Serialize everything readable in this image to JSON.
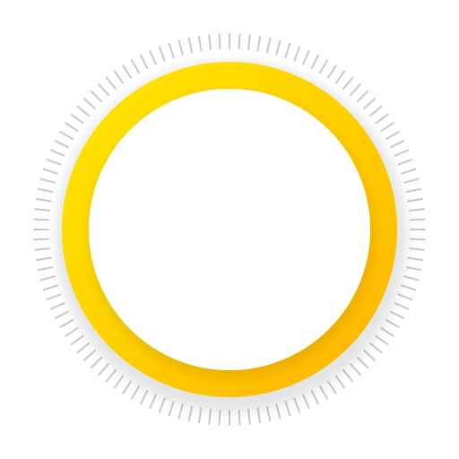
{
  "dial": {
    "tick_count": 120,
    "colors": {
      "tick": "#c9c9c9",
      "ring_start": "#ffe600",
      "ring_mid": "#ffd000",
      "ring_end": "#ffb400",
      "face": "#ffffff",
      "face_shadow": "#d8d8d8"
    }
  }
}
